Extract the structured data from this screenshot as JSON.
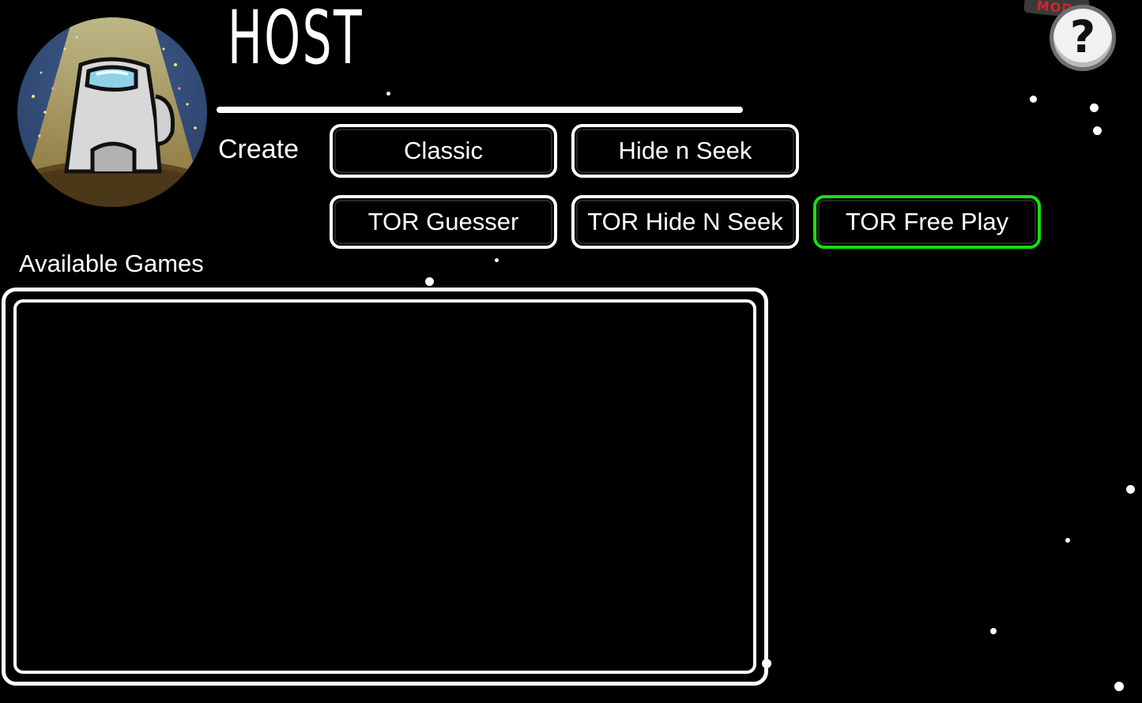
{
  "header": {
    "title": "HOST",
    "avatar_icon": "crewmate-spotlight-icon"
  },
  "create": {
    "label": "Create",
    "modes": [
      {
        "label": "Classic",
        "selected": false
      },
      {
        "label": "Hide n Seek",
        "selected": false
      },
      {
        "label": "TOR Guesser",
        "selected": false
      },
      {
        "label": "TOR Hide N Seek",
        "selected": false
      },
      {
        "label": "TOR Free Play",
        "selected": true
      }
    ]
  },
  "games": {
    "label": "Available Games",
    "items": []
  },
  "help": {
    "glyph": "?",
    "badge": "MOD",
    "icon": "help-icon"
  },
  "colors": {
    "background": "#000000",
    "foreground": "#ffffff",
    "selected_border": "#14e10f",
    "badge_text": "#d42626"
  }
}
